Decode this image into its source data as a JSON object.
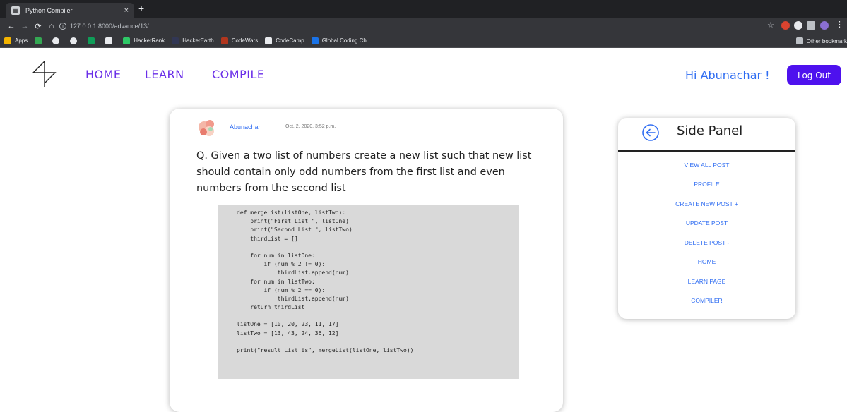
{
  "browser": {
    "tab_title": "Python Compiler",
    "tab_close": "×",
    "new_tab": "+",
    "url": "127.0.0.1:8000/advance/13/",
    "bookmarks": [
      {
        "label": "Apps",
        "color": "#f4b400"
      },
      {
        "label": "",
        "color": "#34a853"
      },
      {
        "label": "",
        "color": "#e8eaed"
      },
      {
        "label": "",
        "color": "#e8eaed"
      },
      {
        "label": "",
        "color": "#0f9d58"
      },
      {
        "label": "",
        "color": "#e8eaed"
      },
      {
        "label": "HackerRank",
        "color": "#2ec866"
      },
      {
        "label": "HackerEarth",
        "color": "#323754"
      },
      {
        "label": "CodeWars",
        "color": "#b1361e"
      },
      {
        "label": "CodeCamp",
        "color": "#e8eaed"
      },
      {
        "label": "Global Coding Ch...",
        "color": "#1a73e8"
      }
    ],
    "other_bookmarks": "Other bookmarks"
  },
  "header": {
    "nav": [
      "HOME",
      "LEARN",
      "COMPILE"
    ],
    "greeting": "Hi Abunachar !",
    "logout_label": "Log Out"
  },
  "post": {
    "author": "Abunachar",
    "date": "Oct. 2, 2020, 3:52 p.m.",
    "question": "Q. Given a two list of numbers create a new list such that new list should contain only odd numbers from the first list and even numbers from the second list",
    "code_lines": [
      "def mergeList(listOne, listTwo):",
      "    print(\"First List \", listOne)",
      "    print(\"Second List \", listTwo)",
      "    thirdList = []",
      "",
      "    for num in listOne:",
      "        if (num % 2 != 0):",
      "            thirdList.append(num)",
      "    for num in listTwo:",
      "        if (num % 2 == 0):",
      "            thirdList.append(num)",
      "    return thirdList",
      "",
      "listOne = [10, 20, 23, 11, 17]",
      "listTwo = [13, 43, 24, 36, 12]",
      "",
      "print(\"result List is\", mergeList(listOne, listTwo))"
    ]
  },
  "side_panel": {
    "title": "Side Panel",
    "links": [
      "VIEW ALL POST",
      "PROFILE",
      "CREATE NEW POST +",
      "UPDATE POST",
      "DELETE POST -",
      "HOME",
      "LEARN PAGE",
      "COMPILER"
    ]
  },
  "colors": {
    "nav": "#6a2ee8",
    "link": "#2f6df2",
    "logout_bg": "#4e11ee"
  }
}
